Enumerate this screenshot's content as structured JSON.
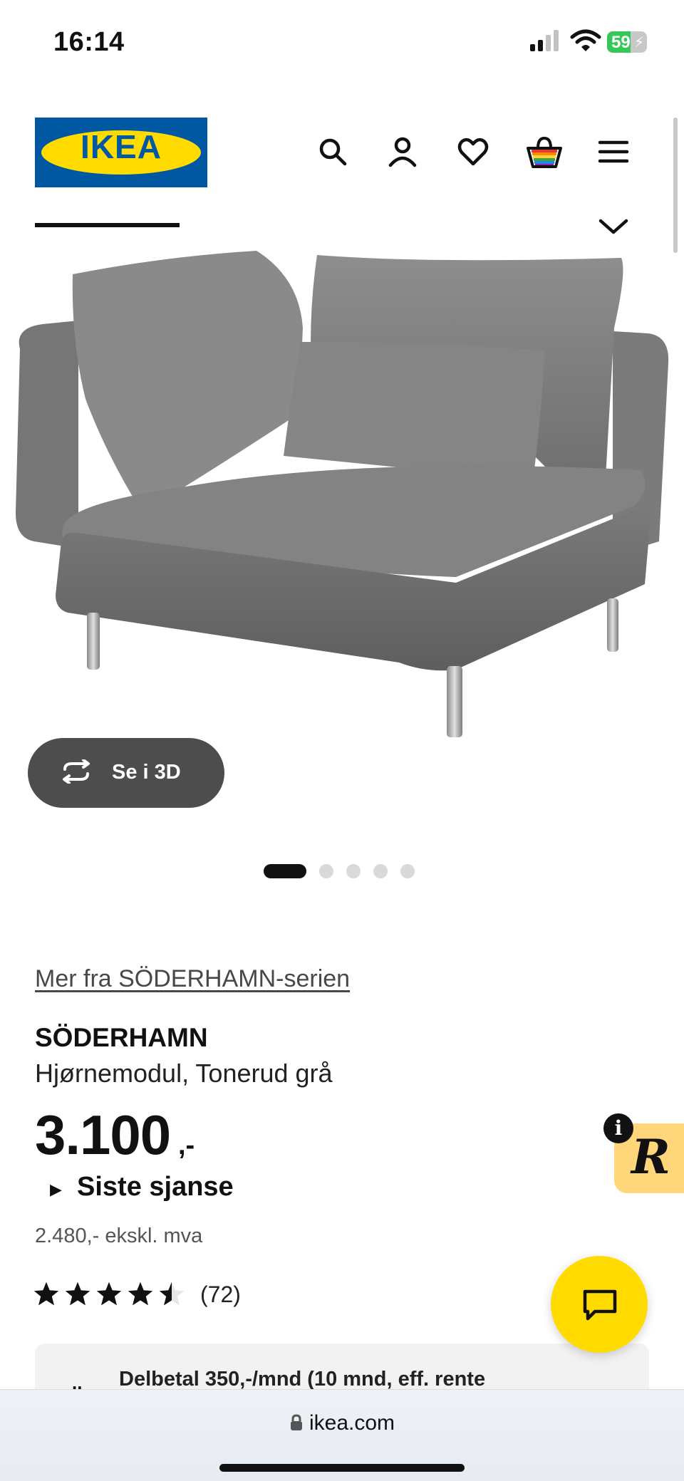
{
  "status_bar": {
    "time": "16:14",
    "battery_level": "59",
    "battery_percent": 59
  },
  "header": {
    "logo_text": "IKEA",
    "icons": [
      "search-icon",
      "account-icon",
      "heart-icon",
      "cart-icon",
      "menu-icon"
    ]
  },
  "gallery": {
    "view_3d_label": "Se i 3D",
    "image_count": 5,
    "active_index": 0
  },
  "product": {
    "series_link": "Mer fra SÖDERHAMN-serien",
    "name": "SÖDERHAMN",
    "description": "Hjørnemodul, Tonerud grå",
    "price": "3.100",
    "price_suffix": ",-",
    "sale_label": "Siste sjanse",
    "price_ex_vat": "2.480,- ekskl. mva",
    "rating_value": 4.5,
    "rating_max": 5,
    "rating_count": "(72)"
  },
  "finance_banner": {
    "text": "Delbetal 350,-/mnd (10 mnd, eff. rente",
    "marker": ".."
  },
  "floating": {
    "badge_letter": "R",
    "info_letter": "i"
  },
  "browser": {
    "url": "ikea.com"
  },
  "colors": {
    "ikea_blue": "#0058a3",
    "ikea_yellow": "#ffdb00",
    "badge_bg": "#ffd77a",
    "dark_button": "#4d4d4d"
  }
}
